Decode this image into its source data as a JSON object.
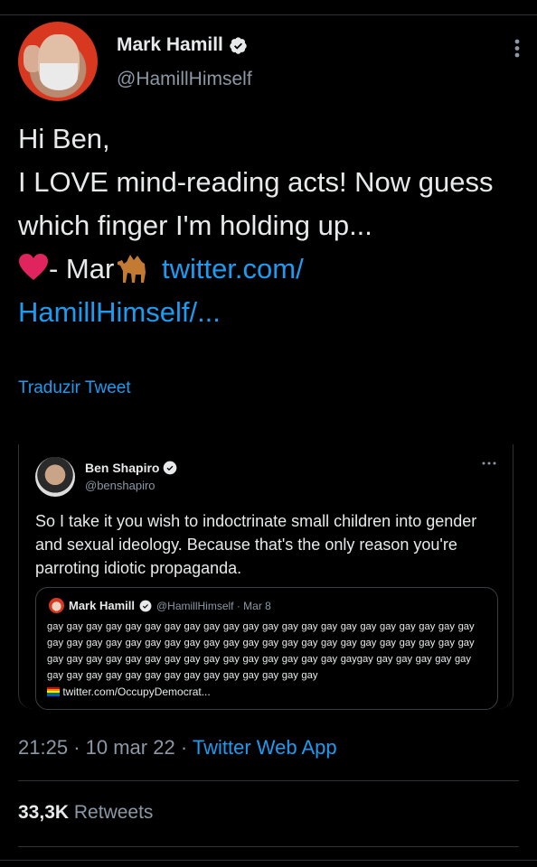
{
  "tweet": {
    "author_name": "Mark Hamill",
    "author_handle": "@HamillHimself",
    "text_line1": "Hi Ben,",
    "text_line2": "I LOVE mind-reading acts! Now guess which finger I'm  holding up...",
    "signoff": "- Mar",
    "link_text": "twitter.com/ HamillHimself/...",
    "translate_label": "Traduzir Tweet",
    "time": "21:25",
    "date": "10 mar 22",
    "app": "Twitter Web App",
    "retweets_count": "33,3K",
    "retweets_label": "Retweets"
  },
  "quoted": {
    "author_name": "Ben Shapiro",
    "author_handle": "@benshapiro",
    "text": "So I take it you wish to indoctrinate small children into gender and sexual ideology. Because that's the only reason you're parroting idiotic propaganda.",
    "inner": {
      "author_name": "Mark Hamill",
      "meta": "@HamillHimself · Mar 8",
      "text": "gay gay gay gay gay gay gay gay gay gay gay gay gay gay gay gay gay gay gay gay gay gay gay gay gay gay gay gay gay gay gay gay gay gay gay gay gay gay gay gay gay gay gay gay gay gay gay gay gay gay gay gay gay gay gay gay gay gay gay gaygay gay gay gay gay gay gay gay gay gay gay gay gay gay gay gay gay gay gay gay",
      "link": "twitter.com/OccupyDemocrat..."
    }
  },
  "colors": {
    "accent": "#1d9bf0",
    "muted": "#8b98a5",
    "background": "#000000",
    "heart": "#e0245e"
  },
  "icons": [
    "verified-badge-icon",
    "more-options-icon",
    "heart-emoji-icon",
    "camel-emoji-icon",
    "rainbow-flag-icon"
  ]
}
